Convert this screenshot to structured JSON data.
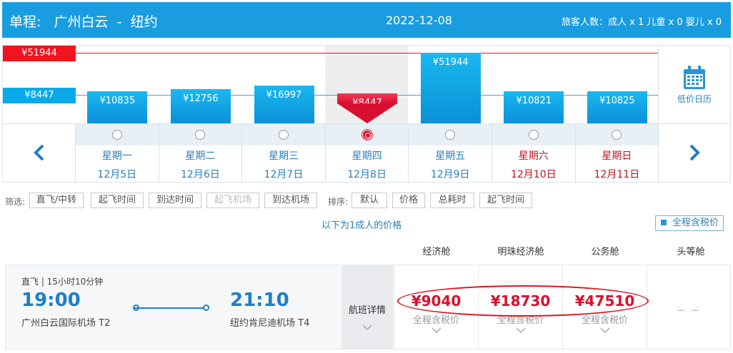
{
  "header": {
    "trip_type": "单程:",
    "from": "广州白云",
    "sep": "-",
    "to": "纽约",
    "date": "2022-12-08",
    "passengers": "旅客人数：成人 x 1   儿童 x 0   婴儿 x 0"
  },
  "calendar": {
    "high_label": "¥51944",
    "low_label": "¥8447",
    "side_label": "低价日历",
    "days": [
      {
        "weekday": "星期一",
        "date": "12月5日",
        "price": "¥10835",
        "price_value": 10835
      },
      {
        "weekday": "星期二",
        "date": "12月6日",
        "price": "¥12756",
        "price_value": 12756
      },
      {
        "weekday": "星期三",
        "date": "12月7日",
        "price": "¥16997",
        "price_value": 16997
      },
      {
        "weekday": "星期四",
        "date": "12月8日",
        "price": "¥8447",
        "price_value": 8447
      },
      {
        "weekday": "星期五",
        "date": "12月9日",
        "price": "¥51944",
        "price_value": 51944
      },
      {
        "weekday": "星期六",
        "date": "12月10日",
        "price": "¥10821",
        "price_value": 10821
      },
      {
        "weekday": "星期日",
        "date": "12月11日",
        "price": "¥10825",
        "price_value": 10825
      }
    ]
  },
  "filters": {
    "filter_label": "筛选:",
    "filter_buttons": [
      "直飞/中转",
      "起飞时间",
      "到达时间",
      "起飞机场",
      "到达机场"
    ],
    "sort_label": "排序:",
    "sort_buttons": [
      "默认",
      "价格",
      "总耗时",
      "起飞时间"
    ]
  },
  "price_note": "以下为1成人的价格",
  "tax_toggle": "全程含税价",
  "cabins": [
    "经济舱",
    "明珠经济舱",
    "公务舱",
    "头等舱"
  ],
  "flight": {
    "meta": "直飞 | 15小时10分钟",
    "dep_time": "19:00",
    "arr_time": "21:10",
    "dep_airport": "广州白云国际机场 T2",
    "arr_airport": "纽约肯尼迪机场 T4",
    "detail_label": "航班详情",
    "prices": [
      {
        "price": "¥9040",
        "tax": "全程含税价"
      },
      {
        "price": "¥18730",
        "tax": "全程含税价"
      },
      {
        "price": "¥47510",
        "tax": "全程含税价"
      }
    ],
    "first_class": "– –"
  },
  "colors": {
    "header_bg": "#1a9de0",
    "bar_blue": "#0a90d8",
    "bar_selected": "#d8102e",
    "weekend_text": "#c0141e"
  }
}
